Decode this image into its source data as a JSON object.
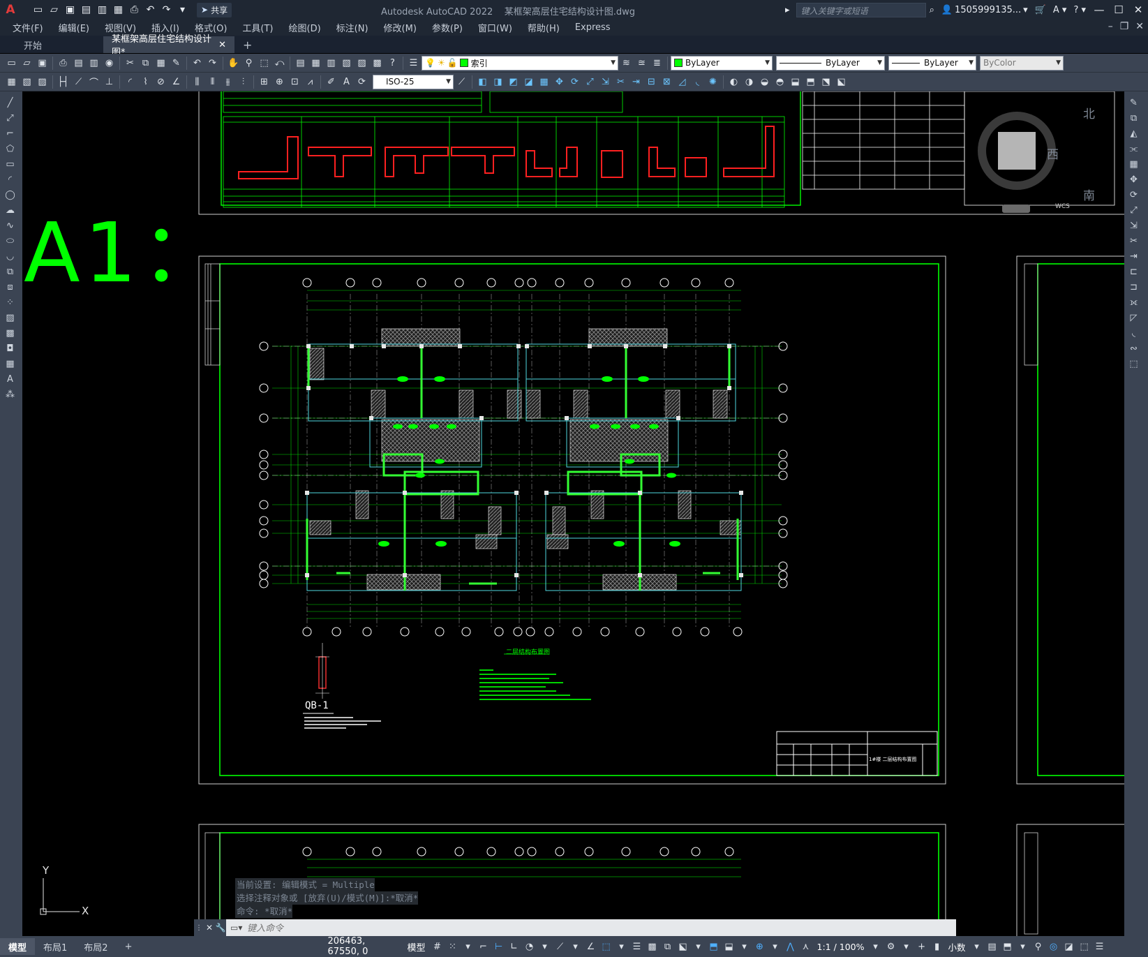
{
  "title_bar": {
    "app_name": "Autodesk AutoCAD 2022",
    "file_name": "某框架高层住宅结构设计图.dwg",
    "share_label": "共享",
    "search_placeholder": "键入关键字或短语",
    "user": "1505999135...",
    "help_icon": "help-icon"
  },
  "menu": [
    "文件(F)",
    "编辑(E)",
    "视图(V)",
    "插入(I)",
    "格式(O)",
    "工具(T)",
    "绘图(D)",
    "标注(N)",
    "修改(M)",
    "参数(P)",
    "窗口(W)",
    "帮助(H)",
    "Express"
  ],
  "file_tabs": {
    "start": "开始",
    "active": "某框架高层住宅结构设计图*"
  },
  "toolbar": {
    "layer_name": "索引",
    "layer_color": "#00ff00",
    "color": "ByLayer",
    "linetype": "ByLayer",
    "lineweight": "ByLayer",
    "plotstyle": "ByColor",
    "dimstyle": "ISO-25"
  },
  "canvas": {
    "sheet_label": "A1：",
    "plan_title": "二层结构布置图",
    "detail_label": "QB-1",
    "title_block_text": "1#楼 二层结构布置图"
  },
  "viewcube": {
    "north": "北",
    "west": "西",
    "south": "南",
    "wcs": "WCS"
  },
  "ucs": {
    "x": "X",
    "y": "Y"
  },
  "command": {
    "history": [
      "当前设置: 编辑模式 = Multiple",
      "选择注释对象或 [放弃(U)/模式(M)]:*取消*",
      "命令: *取消*"
    ],
    "placeholder": "键入命令"
  },
  "status": {
    "tabs": [
      "模型",
      "布局1",
      "布局2"
    ],
    "coordinates": "206463, 67550, 0",
    "space": "模型",
    "scale": "1:1 / 100%",
    "units": "小数"
  },
  "colors": {
    "accent_green": "#00ff00",
    "ui_dark": "#3b4453",
    "title_dark": "#1f2733"
  }
}
